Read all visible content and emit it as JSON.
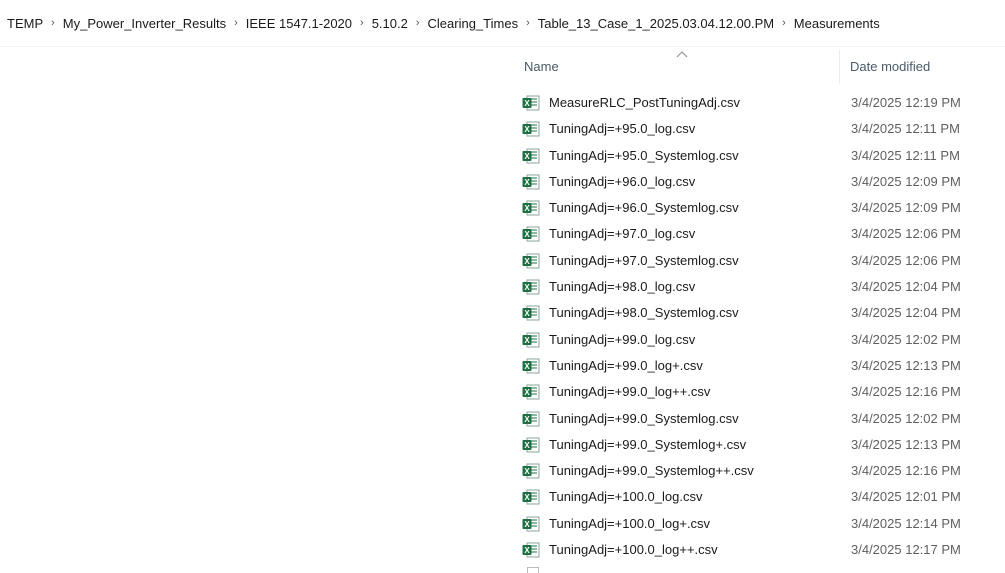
{
  "breadcrumb": [
    "TEMP",
    "My_Power_Inverter_Results",
    "IEEE 1547.1-2020",
    "5.10.2",
    "Clearing_Times",
    "Table_13_Case_1_2025.03.04.12.00.PM",
    "Measurements"
  ],
  "columns": {
    "name": "Name",
    "date_modified": "Date modified"
  },
  "icon": "excel-csv-file-icon",
  "colors": {
    "excel_green": "#1d7044",
    "header_text": "#4a5a6a"
  },
  "files": [
    {
      "name": "MeasureRLC_PostTuningAdj.csv",
      "date": "3/4/2025 12:19 PM"
    },
    {
      "name": "TuningAdj=+95.0_log.csv",
      "date": "3/4/2025 12:11 PM"
    },
    {
      "name": "TuningAdj=+95.0_Systemlog.csv",
      "date": "3/4/2025 12:11 PM"
    },
    {
      "name": "TuningAdj=+96.0_log.csv",
      "date": "3/4/2025 12:09 PM"
    },
    {
      "name": "TuningAdj=+96.0_Systemlog.csv",
      "date": "3/4/2025 12:09 PM"
    },
    {
      "name": "TuningAdj=+97.0_log.csv",
      "date": "3/4/2025 12:06 PM"
    },
    {
      "name": "TuningAdj=+97.0_Systemlog.csv",
      "date": "3/4/2025 12:06 PM"
    },
    {
      "name": "TuningAdj=+98.0_log.csv",
      "date": "3/4/2025 12:04 PM"
    },
    {
      "name": "TuningAdj=+98.0_Systemlog.csv",
      "date": "3/4/2025 12:04 PM"
    },
    {
      "name": "TuningAdj=+99.0_log.csv",
      "date": "3/4/2025 12:02 PM"
    },
    {
      "name": "TuningAdj=+99.0_log+.csv",
      "date": "3/4/2025 12:13 PM"
    },
    {
      "name": "TuningAdj=+99.0_log++.csv",
      "date": "3/4/2025 12:16 PM"
    },
    {
      "name": "TuningAdj=+99.0_Systemlog.csv",
      "date": "3/4/2025 12:02 PM"
    },
    {
      "name": "TuningAdj=+99.0_Systemlog+.csv",
      "date": "3/4/2025 12:13 PM"
    },
    {
      "name": "TuningAdj=+99.0_Systemlog++.csv",
      "date": "3/4/2025 12:16 PM"
    },
    {
      "name": "TuningAdj=+100.0_log.csv",
      "date": "3/4/2025 12:01 PM"
    },
    {
      "name": "TuningAdj=+100.0_log+.csv",
      "date": "3/4/2025 12:14 PM"
    },
    {
      "name": "TuningAdj=+100.0_log++.csv",
      "date": "3/4/2025 12:17 PM"
    }
  ]
}
